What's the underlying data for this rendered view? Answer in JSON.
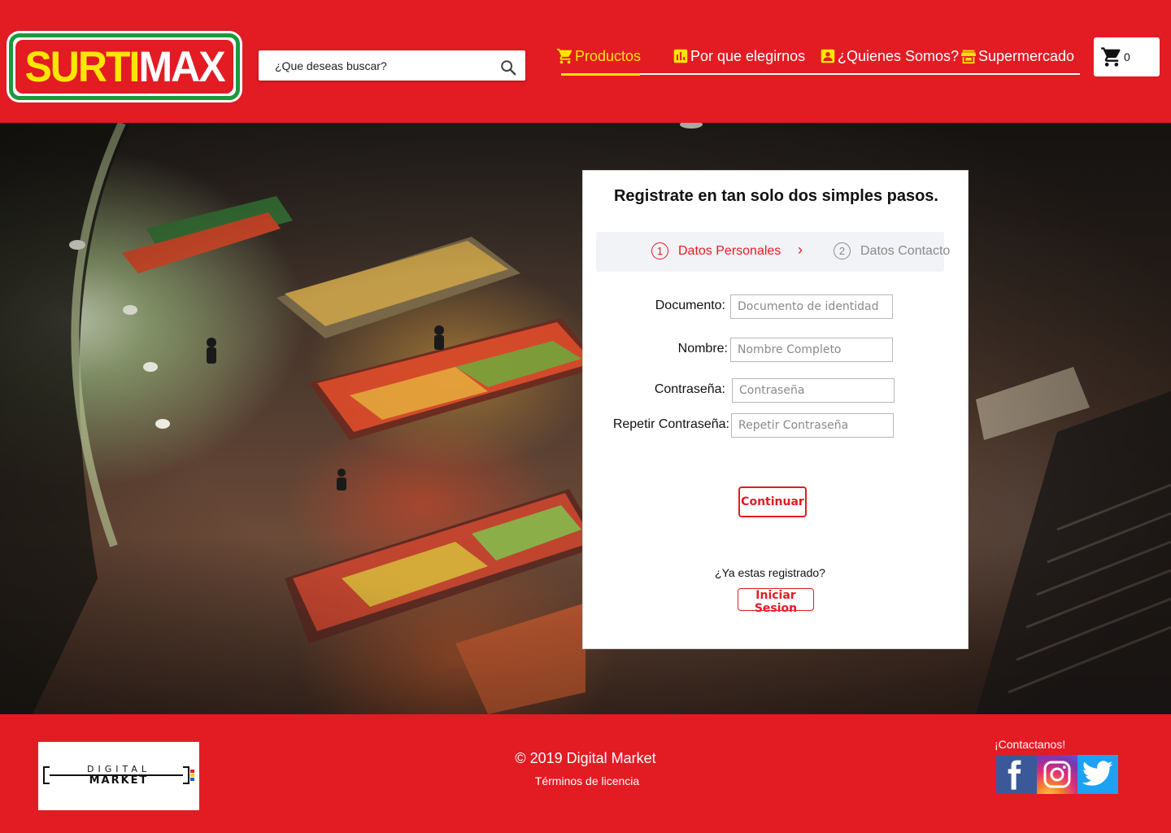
{
  "brand": {
    "logo_part1": "SURTI",
    "logo_part2": "MAX",
    "primary_color": "#e31b23",
    "accent_color": "#ffe600",
    "logo_green": "#1a9a3c"
  },
  "search": {
    "placeholder": "¿Que deseas buscar?",
    "icon": "search-icon"
  },
  "nav": {
    "items": [
      {
        "label": "Productos",
        "icon": "shopping-cart-icon",
        "active": true
      },
      {
        "label": "Por que elegirnos",
        "icon": "bar-chart-icon",
        "active": false
      },
      {
        "label": "¿Quienes Somos?",
        "icon": "contact-card-icon",
        "active": false
      },
      {
        "label": "Supermercado",
        "icon": "storefront-icon",
        "active": false
      }
    ]
  },
  "cart": {
    "icon": "cart-icon",
    "count": "0"
  },
  "register": {
    "title": "Registrate en tan solo dos simples pasos.",
    "steps": [
      {
        "number": "1",
        "label": "Datos Personales",
        "active": true
      },
      {
        "number": "2",
        "label": "Datos Contacto",
        "active": false
      }
    ],
    "step_separator": "›",
    "fields": [
      {
        "label": "Documento:",
        "placeholder": "Documento de identidad"
      },
      {
        "label": "Nombre:",
        "placeholder": "Nombre Completo"
      },
      {
        "label": "Contraseña:",
        "placeholder": "Contraseña"
      },
      {
        "label": "Repetir Contraseña:",
        "placeholder": "Repetir Contraseña"
      }
    ],
    "continue_label": "Continuar",
    "already_registered": "¿Ya estas registrado?",
    "login_label": "Iniciar Sesion"
  },
  "footer": {
    "partner_logo_line1": "DIGITAL",
    "partner_logo_line2": "MARKET",
    "copyright": "© 2019 Digital Market",
    "terms": "Términos de licencia",
    "contact_label": "¡Contactanos!",
    "social": [
      "facebook-icon",
      "instagram-icon",
      "twitter-icon"
    ]
  }
}
